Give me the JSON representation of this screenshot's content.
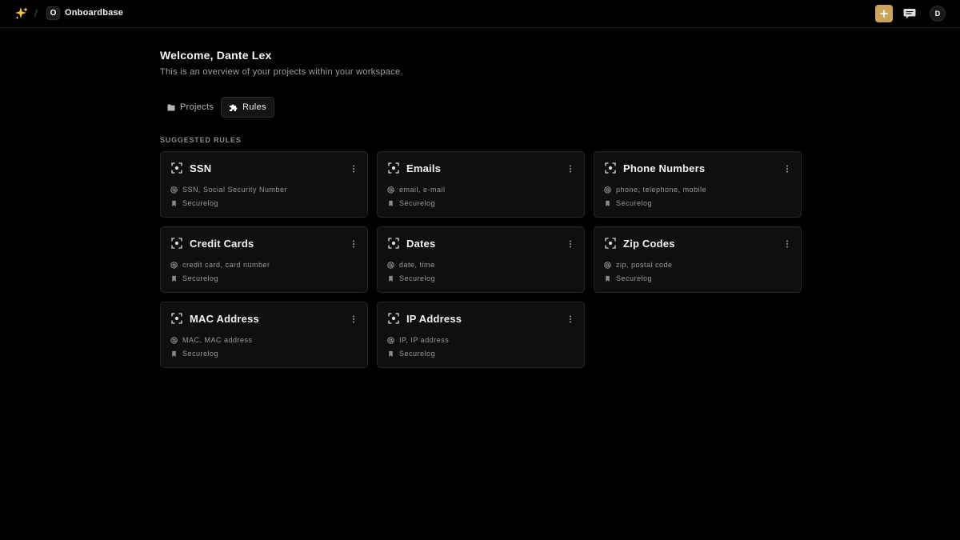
{
  "topbar": {
    "workspace_initial": "O",
    "workspace_name": "Onboardbase",
    "user_initial": "D",
    "icons": [
      "sparkles-icon",
      "plus-icon",
      "chat-icon"
    ],
    "accent_color": "#c9a45a"
  },
  "header": {
    "title": "Welcome, Dante Lex",
    "subtitle": "This is an overview of your projects within your workspace."
  },
  "tabs": [
    {
      "label": "Projects",
      "icon": "folder-icon",
      "active": false
    },
    {
      "label": "Rules",
      "icon": "puzzle-icon",
      "active": true
    }
  ],
  "section_label": "SUGGESTED RULES",
  "rules": [
    {
      "title": "SSN",
      "keywords": "SSN, Social Security Number",
      "source": "Securelog"
    },
    {
      "title": "Emails",
      "keywords": "email, e-mail",
      "source": "Securelog"
    },
    {
      "title": "Phone Numbers",
      "keywords": "phone, telephone, mobile",
      "source": "Securelog"
    },
    {
      "title": "Credit Cards",
      "keywords": "credit card, card number",
      "source": "Securelog"
    },
    {
      "title": "Dates",
      "keywords": "date, time",
      "source": "Securelog"
    },
    {
      "title": "Zip Codes",
      "keywords": "zip, postal code",
      "source": "Securelog"
    },
    {
      "title": "MAC Address",
      "keywords": "MAC, MAC address",
      "source": "Securelog"
    },
    {
      "title": "IP Address",
      "keywords": "IP, IP address",
      "source": "Securelog"
    }
  ]
}
